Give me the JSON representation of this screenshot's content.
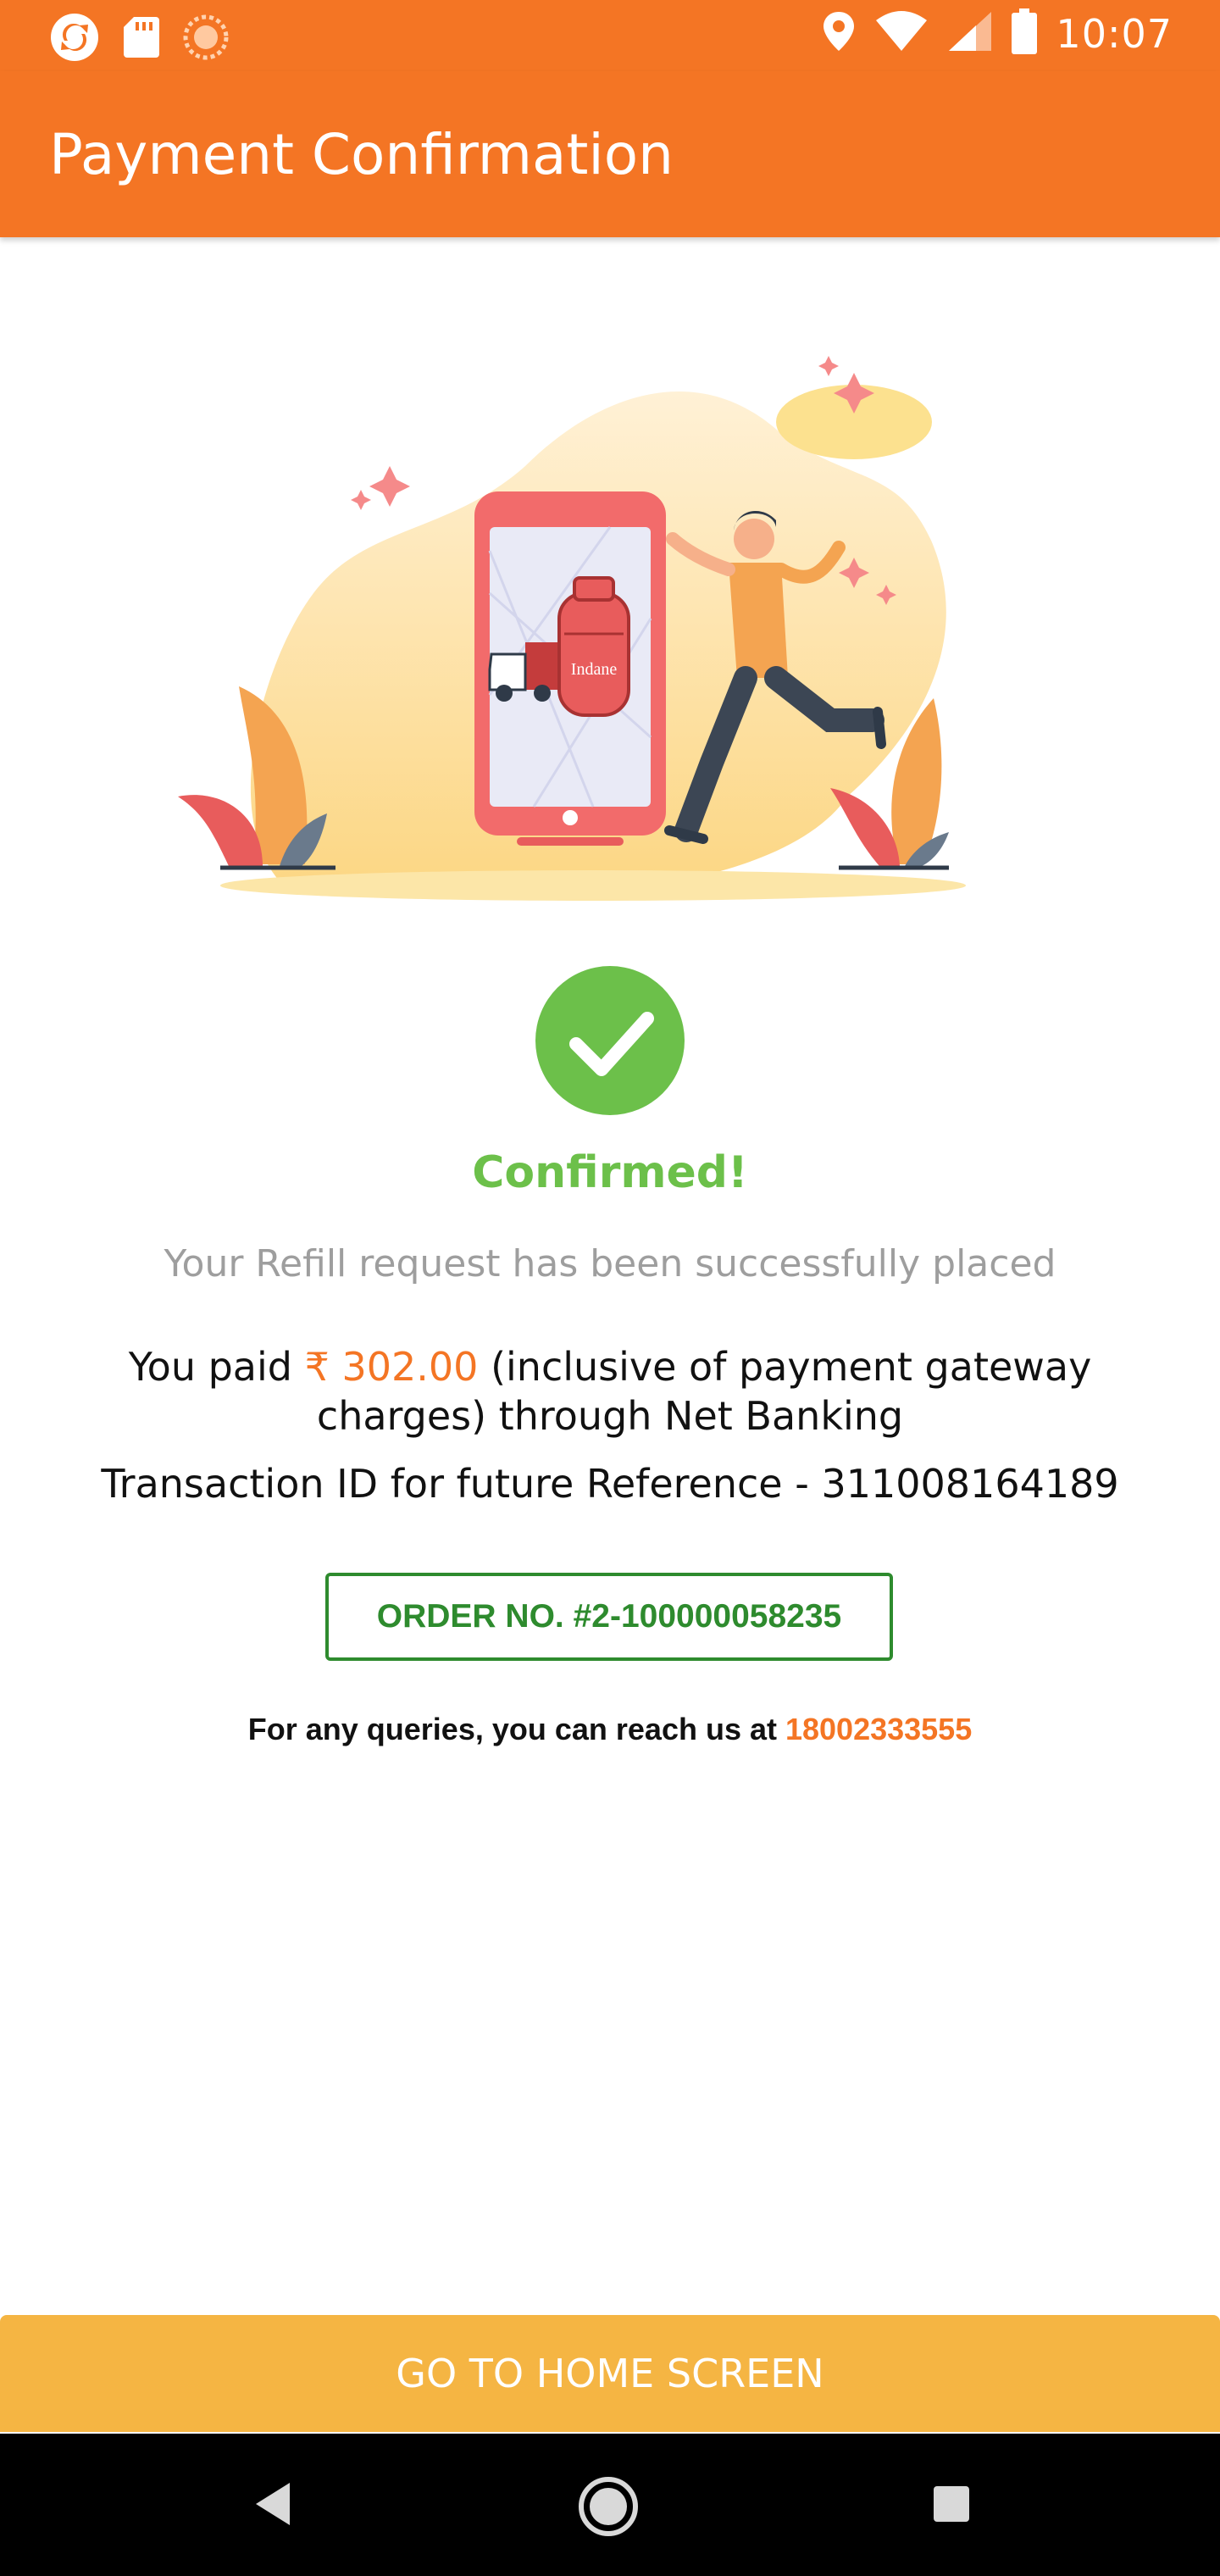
{
  "status_bar": {
    "time": "10:07",
    "icons": [
      "app-sync-icon",
      "sd-card-icon",
      "sunflower-icon",
      "location-icon",
      "wifi-icon",
      "signal-icon",
      "battery-icon"
    ]
  },
  "app_bar": {
    "title": "Payment Confirmation"
  },
  "hero": {
    "illustration": "delivery-illustration",
    "cylinder_brand": "Indane"
  },
  "confirmation": {
    "status": "Confirmed!",
    "subtitle": "Your Refill request has been successfully placed",
    "paid_prefix": "You paid",
    "amount": "₹ 302.00",
    "paid_suffix": "(inclusive of payment gateway charges) through Net Banking",
    "transaction_label": "Transaction ID for future Reference - ",
    "transaction_id": "311008164189",
    "order_number": "ORDER NO. #2-100000058235",
    "queries_label": "For any queries, you can reach us at ",
    "phone": "18002333555"
  },
  "home_button": {
    "label": "GO TO HOME SCREEN"
  },
  "colors": {
    "primary": "#F47524",
    "success": "#6CC04A",
    "order_green": "#2E8B2E",
    "button": "#F5B543"
  },
  "nav": {
    "icons": [
      "back-icon",
      "home-icon",
      "recents-icon"
    ]
  }
}
